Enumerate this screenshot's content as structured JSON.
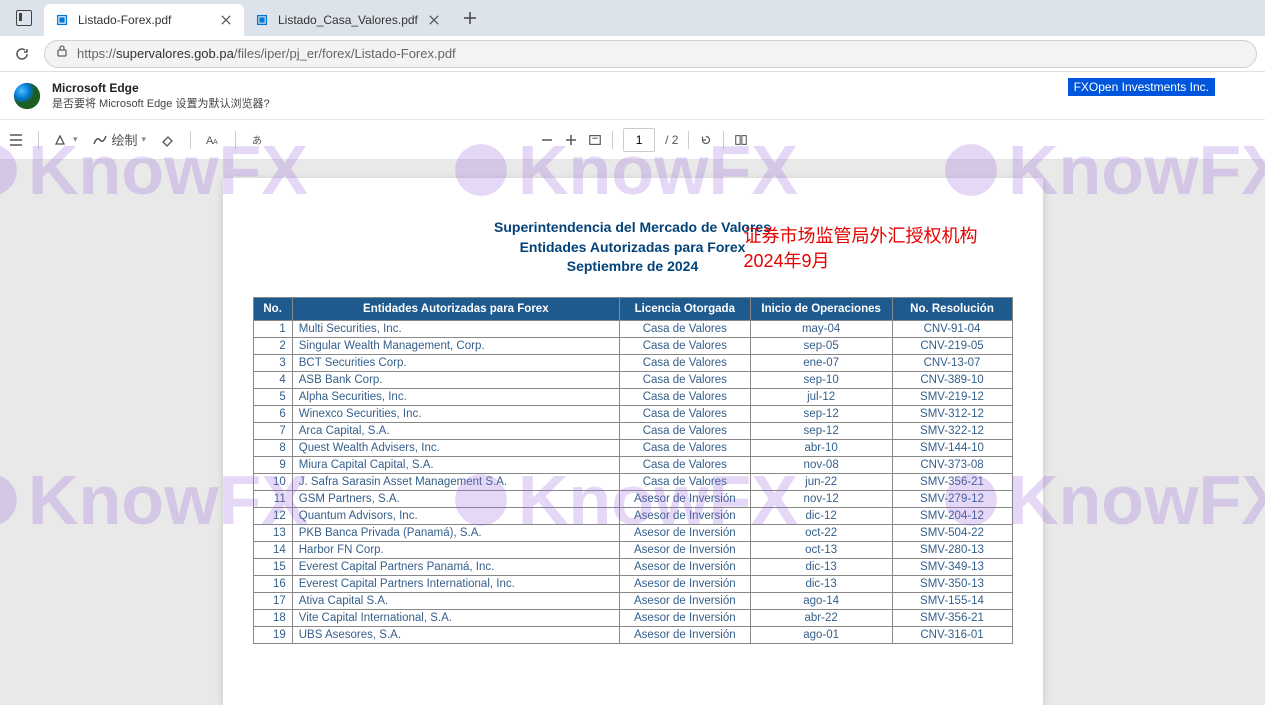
{
  "browser": {
    "tabs": [
      {
        "title": "Listado-Forex.pdf",
        "active": true
      },
      {
        "title": "Listado_Casa_Valores.pdf",
        "active": false
      }
    ],
    "url_prefix": "https://",
    "url_host": "supervalores.gob.pa",
    "url_path": "/files/iper/pj_er/forex/Listado-Forex.pdf"
  },
  "banner": {
    "title": "Microsoft Edge",
    "subtitle": "是否要将 Microsoft Edge 设置为默认浏览器?",
    "highlight": "FXOpen Investments Inc."
  },
  "toolbar": {
    "draw_label": "绘制",
    "page_current": "1",
    "page_total": "/ 2"
  },
  "doc": {
    "title1": "Superintendencia del Mercado de Valores",
    "title2": "Entidades Autorizadas para Forex",
    "title3": "Septiembre de 2024",
    "red_annotation1": "证券市场监管局外汇授权机构",
    "red_annotation2": "2024年9月",
    "headers": [
      "No.",
      "Entidades Autorizadas para Forex",
      "Licencia Otorgada",
      "Inicio de Operaciones",
      "No. Resolución"
    ],
    "rows": [
      {
        "no": "1",
        "name": "Multi Securities, Inc.",
        "lic": "Casa de Valores",
        "date": "may-04",
        "res": "CNV-91-04"
      },
      {
        "no": "2",
        "name": "Singular Wealth Management, Corp.",
        "lic": "Casa de Valores",
        "date": "sep-05",
        "res": "CNV-219-05"
      },
      {
        "no": "3",
        "name": "BCT Securities Corp.",
        "lic": "Casa de Valores",
        "date": "ene-07",
        "res": "CNV-13-07"
      },
      {
        "no": "4",
        "name": "ASB Bank Corp.",
        "lic": "Casa de Valores",
        "date": "sep-10",
        "res": "CNV-389-10"
      },
      {
        "no": "5",
        "name": "Alpha Securities, Inc.",
        "lic": "Casa de Valores",
        "date": "jul-12",
        "res": "SMV-219-12"
      },
      {
        "no": "6",
        "name": "Winexco Securities, Inc.",
        "lic": "Casa de Valores",
        "date": "sep-12",
        "res": "SMV-312-12"
      },
      {
        "no": "7",
        "name": "Arca Capital, S.A.",
        "lic": "Casa de Valores",
        "date": "sep-12",
        "res": "SMV-322-12"
      },
      {
        "no": "8",
        "name": "Quest Wealth Advisers, Inc.",
        "lic": "Casa de Valores",
        "date": "abr-10",
        "res": "SMV-144-10"
      },
      {
        "no": "9",
        "name": "Miura Capital Capital, S.A.",
        "lic": "Casa de Valores",
        "date": "nov-08",
        "res": "CNV-373-08"
      },
      {
        "no": "10",
        "name": "J. Safra Sarasin Asset Management S.A.",
        "lic": "Casa de Valores",
        "date": "jun-22",
        "res": "SMV-356-21"
      },
      {
        "no": "11",
        "name": "GSM Partners, S.A.",
        "lic": "Asesor de Inversión",
        "date": "nov-12",
        "res": "SMV-279-12"
      },
      {
        "no": "12",
        "name": "Quantum Advisors, Inc.",
        "lic": "Asesor de Inversión",
        "date": "dic-12",
        "res": "SMV-204-12"
      },
      {
        "no": "13",
        "name": "PKB Banca Privada (Panamá), S.A.",
        "lic": "Asesor de Inversión",
        "date": "oct-22",
        "res": "SMV-504-22"
      },
      {
        "no": "14",
        "name": "Harbor FN Corp.",
        "lic": "Asesor de Inversión",
        "date": "oct-13",
        "res": "SMV-280-13"
      },
      {
        "no": "15",
        "name": "Everest Capital Partners Panamá, Inc.",
        "lic": "Asesor de Inversión",
        "date": "dic-13",
        "res": "SMV-349-13"
      },
      {
        "no": "16",
        "name": "Everest Capital Partners International, Inc.",
        "lic": "Asesor de Inversión",
        "date": "dic-13",
        "res": "SMV-350-13"
      },
      {
        "no": "17",
        "name": "Ativa Capital S.A.",
        "lic": "Asesor de Inversión",
        "date": "ago-14",
        "res": "SMV-155-14"
      },
      {
        "no": "18",
        "name": "Vite Capital International, S.A.",
        "lic": "Asesor de Inversión",
        "date": "abr-22",
        "res": "SMV-356-21"
      },
      {
        "no": "19",
        "name": "UBS Asesores, S.A.",
        "lic": "Asesor de Inversión",
        "date": "ago-01",
        "res": "CNV-316-01"
      }
    ]
  },
  "watermark": "KnowFX"
}
